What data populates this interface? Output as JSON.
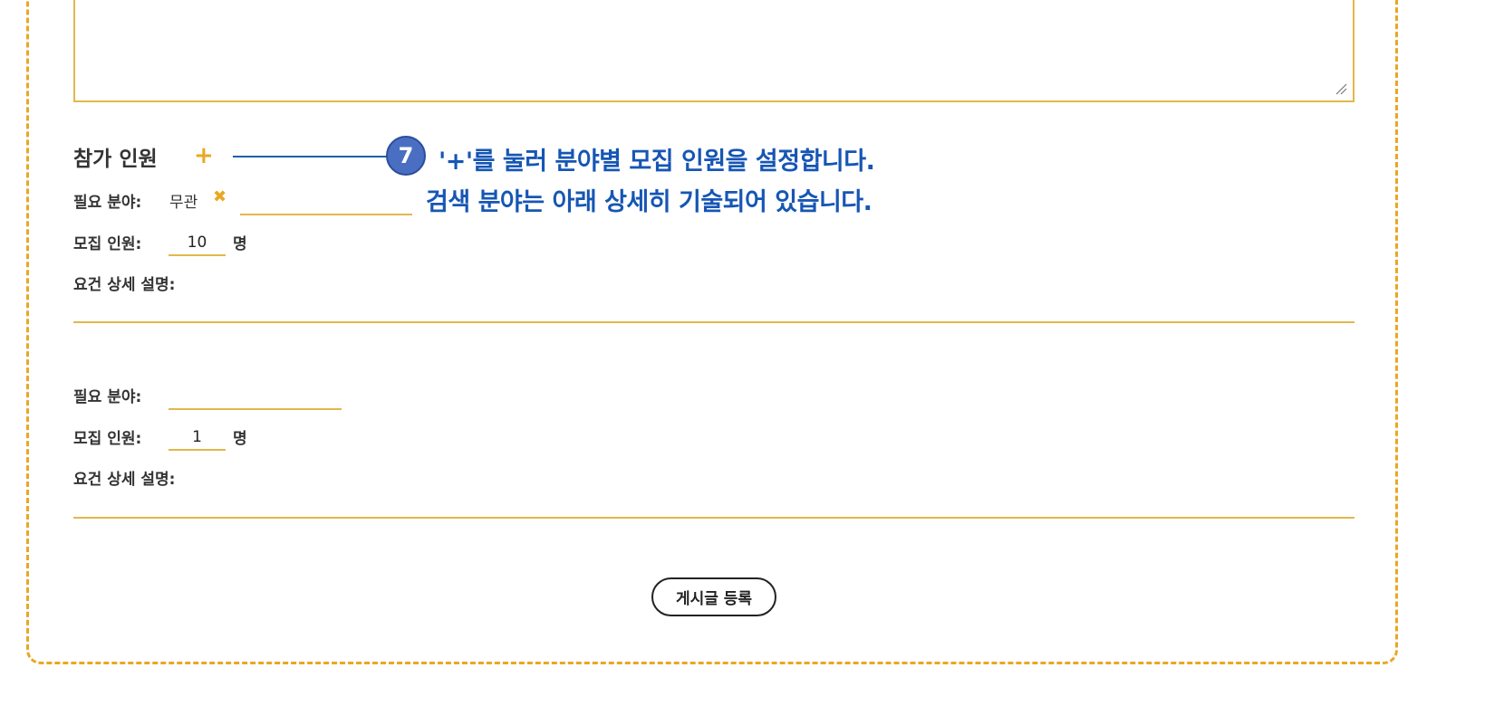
{
  "participants": {
    "section_title": "참가 인원",
    "add_icon": "+",
    "callout": {
      "step_number": "7",
      "line1": "'+'를 눌러 분야별 모집 인원을 설정합니다.",
      "line2": "검색 분야는 아래 상세히 기술되어 있습니다."
    },
    "entries": [
      {
        "field_label": "필요 분야:",
        "field_tag": "무관",
        "remove_icon": "✖",
        "field_input_value": "",
        "count_label": "모집 인원:",
        "count_value": "10",
        "count_unit": "명",
        "detail_label": "요건 상세 설명:"
      },
      {
        "field_label": "필요 분야:",
        "field_input_value": "",
        "count_label": "모집 인원:",
        "count_value": "1",
        "count_unit": "명",
        "detail_label": "요건 상세 설명:"
      }
    ]
  },
  "submit": {
    "label": "게시글 등록"
  },
  "colors": {
    "accent": "#e8a823",
    "callout": "#1656b4",
    "badge": "#4a6fc2"
  },
  "icons": {
    "add": "plus-icon",
    "remove": "close-icon",
    "resize": "resize-grip-icon"
  }
}
